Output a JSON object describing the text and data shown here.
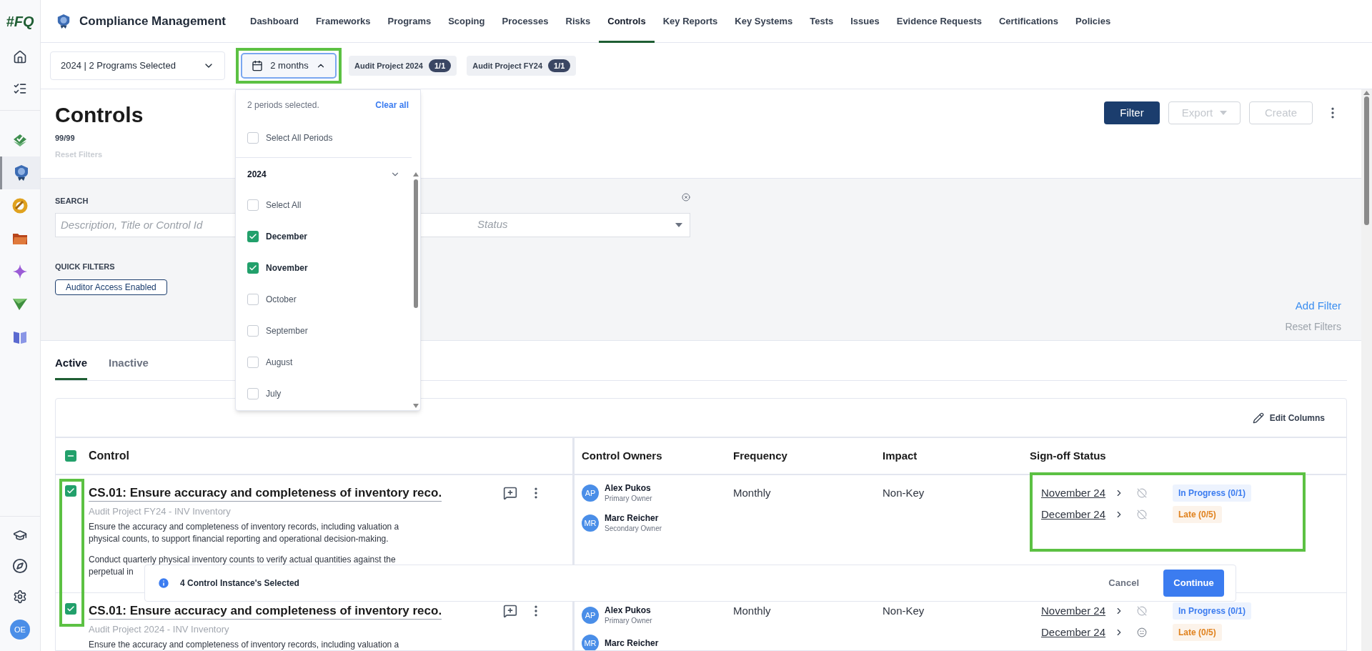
{
  "brand": {
    "logo": "#FQ",
    "app_title": "Compliance Management"
  },
  "nav": [
    {
      "label": "Dashboard",
      "selected": false
    },
    {
      "label": "Frameworks",
      "selected": false
    },
    {
      "label": "Programs",
      "selected": false
    },
    {
      "label": "Scoping",
      "selected": false
    },
    {
      "label": "Processes",
      "selected": false
    },
    {
      "label": "Risks",
      "selected": false
    },
    {
      "label": "Controls",
      "selected": true
    },
    {
      "label": "Key Reports",
      "selected": false
    },
    {
      "label": "Key Systems",
      "selected": false
    },
    {
      "label": "Tests",
      "selected": false
    },
    {
      "label": "Issues",
      "selected": false
    },
    {
      "label": "Evidence Requests",
      "selected": false
    },
    {
      "label": "Certifications",
      "selected": false
    },
    {
      "label": "Policies",
      "selected": false
    }
  ],
  "sidebar": {
    "top": [
      {
        "kind": "home"
      },
      {
        "kind": "tasks"
      }
    ],
    "apps": [
      {
        "kind": "layers",
        "selected": false
      },
      {
        "kind": "badge",
        "selected": true
      },
      {
        "kind": "ring",
        "selected": false
      },
      {
        "kind": "folder",
        "selected": false
      },
      {
        "kind": "sparkle",
        "selected": false
      },
      {
        "kind": "plane",
        "selected": false
      },
      {
        "kind": "book",
        "selected": false
      }
    ],
    "bottom": [
      {
        "kind": "cap"
      },
      {
        "kind": "compass"
      },
      {
        "kind": "settings"
      }
    ],
    "avatar": "OE"
  },
  "toolbar": {
    "program_select": "2024 | 2 Programs Selected",
    "period_button": {
      "label": "2 months",
      "expanded": true,
      "highlighted": true
    },
    "chips": [
      {
        "label": "Audit Project 2024",
        "count": "1/1"
      },
      {
        "label": "Audit Project FY24",
        "count": "1/1"
      }
    ]
  },
  "period_menu": {
    "summary": "2 periods selected.",
    "clear": "Clear all",
    "select_all": {
      "label": "Select All Periods",
      "checked": false
    },
    "year": "2024",
    "year_expanded": true,
    "options": [
      {
        "label": "Select All",
        "checked": false
      },
      {
        "label": "December",
        "checked": true
      },
      {
        "label": "November",
        "checked": true
      },
      {
        "label": "October",
        "checked": false
      },
      {
        "label": "September",
        "checked": false
      },
      {
        "label": "August",
        "checked": false
      },
      {
        "label": "July",
        "checked": false
      }
    ]
  },
  "header": {
    "title": "Controls",
    "count": "99/99",
    "reset": "Reset Filters",
    "buttons": [
      {
        "label": "Filter",
        "kind": "primary",
        "disabled": false
      },
      {
        "label": "Export",
        "kind": "menu",
        "disabled": true
      },
      {
        "label": "Create",
        "kind": "plain",
        "disabled": true
      }
    ]
  },
  "filters": {
    "search_label": "SEARCH",
    "search_placeholder": "Description, Title or Control Id",
    "status_placeholder": "Status",
    "quick_filters_label": "QUICK FILTERS",
    "quick_filters": [
      "Auditor Access Enabled"
    ],
    "add_filter": "Add Filter",
    "reset_filters": "Reset Filters"
  },
  "tabs": [
    {
      "label": "Active",
      "selected": true
    },
    {
      "label": "Inactive",
      "selected": false
    }
  ],
  "table": {
    "edit_columns": "Edit Columns",
    "select_all_partial": true,
    "checkbox_column_highlighted": true,
    "columns": [
      "Control",
      "Control Owners",
      "Frequency",
      "Impact",
      "Sign-off Status"
    ],
    "rows": [
      {
        "selected": true,
        "title": "CS.01: Ensure accuracy and completeness of inventory reco.",
        "subtitle": "Audit Project FY24 - INV Inventory",
        "description": [
          [
            "Ensure the accuracy and completeness of inventory records, including valuation a",
            "physical counts, to support financial reporting and operational decision-making."
          ],
          [
            "Conduct quarterly physical inventory counts to verify actual quantities against the",
            "perpetual in"
          ]
        ],
        "owners": [
          {
            "initials": "AP",
            "name": "Alex Pukos",
            "role": "Primary Owner"
          },
          {
            "initials": "MR",
            "name": "Marc Reicher",
            "role": "Secondary Owner"
          }
        ],
        "frequency": "Monthly",
        "impact": "Non-Key",
        "signoff_highlighted": true,
        "signoffs": [
          {
            "period": "November 24",
            "kind": "crossed",
            "status": "In Progress (0/1)",
            "color": "#3b7cf0"
          },
          {
            "period": "December 24",
            "kind": "crossed",
            "status": "Late (0/5)",
            "color": "#e0821e"
          }
        ]
      },
      {
        "selected": true,
        "title": "CS.01: Ensure accuracy and completeness of inventory reco.",
        "subtitle": "Audit Project 2024 - INV Inventory",
        "description": [
          [
            "Ensure the accuracy and completeness of inventory records, including valuation a"
          ]
        ],
        "owners": [
          {
            "initials": "AP",
            "name": "Alex Pukos",
            "role": "Primary Owner"
          },
          {
            "initials": "MR",
            "name": "Marc Reicher"
          }
        ],
        "frequency": "Monthly",
        "impact": "Non-Key",
        "signoffs": [
          {
            "period": "November 24",
            "kind": "crossed",
            "status": "In Progress (0/1)",
            "color": "#3b7cf0"
          },
          {
            "period": "December 24",
            "kind": "face",
            "status": "Late (0/5)",
            "color": "#e0821e"
          }
        ]
      }
    ]
  },
  "selection_bar": {
    "message": "4 Control Instance's Selected",
    "cancel": "Cancel",
    "continue": "Continue"
  }
}
